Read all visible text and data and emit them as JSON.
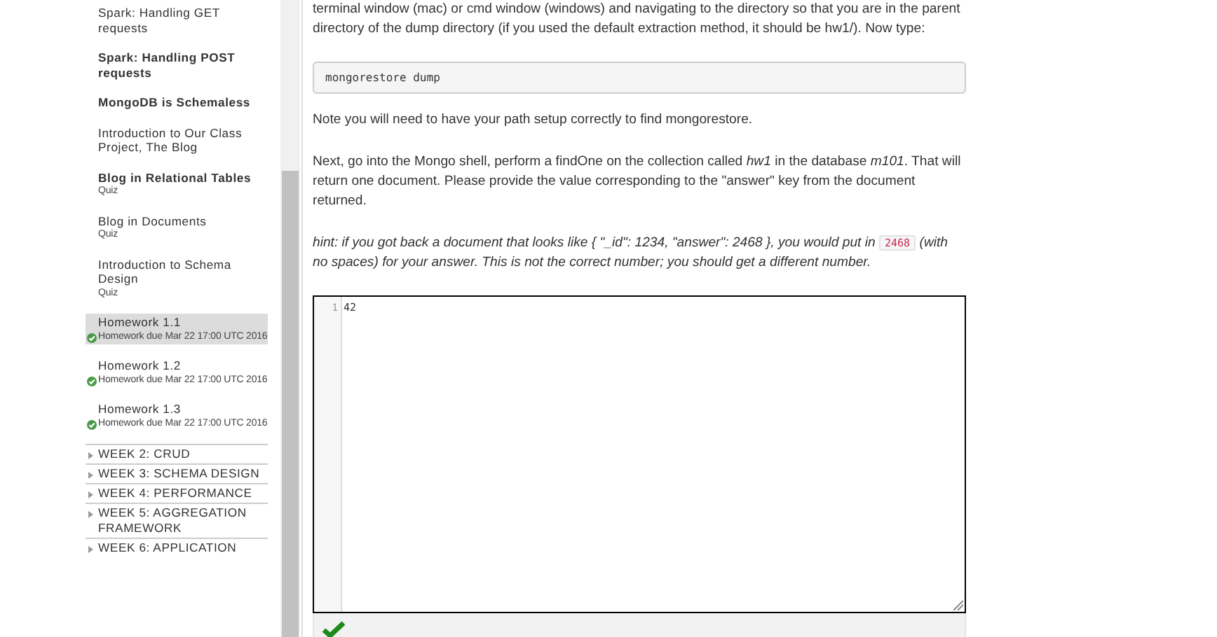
{
  "sidebar": {
    "items": [
      {
        "kind": "lesson",
        "title": "Spark: Handling GET requests",
        "unread": false,
        "selected": false
      },
      {
        "kind": "lesson",
        "title": "Spark: Handling POST requests",
        "unread": true,
        "selected": false
      },
      {
        "kind": "lesson",
        "title": "MongoDB is Schemaless",
        "unread": true,
        "selected": false
      },
      {
        "kind": "lesson",
        "title": "Introduction to Our Class Project, The Blog",
        "unread": false,
        "selected": false
      },
      {
        "kind": "quiz",
        "title": "Blog in Relational Tables",
        "subtitle": "Quiz",
        "unread": true,
        "selected": false
      },
      {
        "kind": "quiz",
        "title": "Blog in Documents",
        "subtitle": "Quiz",
        "unread": false,
        "selected": false
      },
      {
        "kind": "quiz",
        "title": "Introduction to Schema Design",
        "subtitle": "Quiz",
        "unread": false,
        "selected": false
      },
      {
        "kind": "homework",
        "title": "Homework 1.1",
        "subtitle": "Homework due Mar 22 17:00 UTC 2016",
        "completed": true,
        "selected": true
      },
      {
        "kind": "homework",
        "title": "Homework 1.2",
        "subtitle": "Homework due Mar 22 17:00 UTC 2016",
        "completed": true,
        "selected": false
      },
      {
        "kind": "homework",
        "title": "Homework 1.3",
        "subtitle": "Homework due Mar 22 17:00 UTC 2016",
        "completed": true,
        "selected": false
      },
      {
        "kind": "week",
        "title": "WEEK 2: CRUD",
        "expanded": false
      },
      {
        "kind": "week",
        "title": "WEEK 3: SCHEMA DESIGN",
        "expanded": false
      },
      {
        "kind": "week",
        "title": "WEEK 4: PERFORMANCE",
        "expanded": false
      },
      {
        "kind": "week",
        "title": "WEEK 5: AGGREGATION FRAMEWORK",
        "expanded": false
      },
      {
        "kind": "week",
        "title": "WEEK 6: APPLICATION",
        "expanded": false
      }
    ]
  },
  "content": {
    "paragraphs": [
      {
        "kind": "text",
        "text": "terminal window (mac) or cmd window (windows) and navigating to the directory so that you are in the parent directory of the dump directory (if you used the default extraction method, it should be hw1/). Now type:"
      },
      {
        "kind": "code",
        "text": "mongorestore dump"
      },
      {
        "kind": "text",
        "text": "Note you will need to have your path setup correctly to find mongorestore."
      },
      {
        "kind": "text",
        "text": "Next, go into the Mongo shell, perform a findOne on the collection called *hw1* in the database *m101*. That will return one document. Please provide the value corresponding to the \"answer\" key from the document returned."
      },
      {
        "kind": "hint",
        "parts": [
          "hint: if you got back a document that looks like { \"_id\": 1234, \"answer\": 2468 }, you would put in",
          "2468",
          "(with no spaces) for your answer. This is not the correct number; you should get a different number."
        ]
      }
    ],
    "editor": {
      "line_number": "1",
      "value": "42"
    },
    "result": {
      "correct": true
    }
  }
}
